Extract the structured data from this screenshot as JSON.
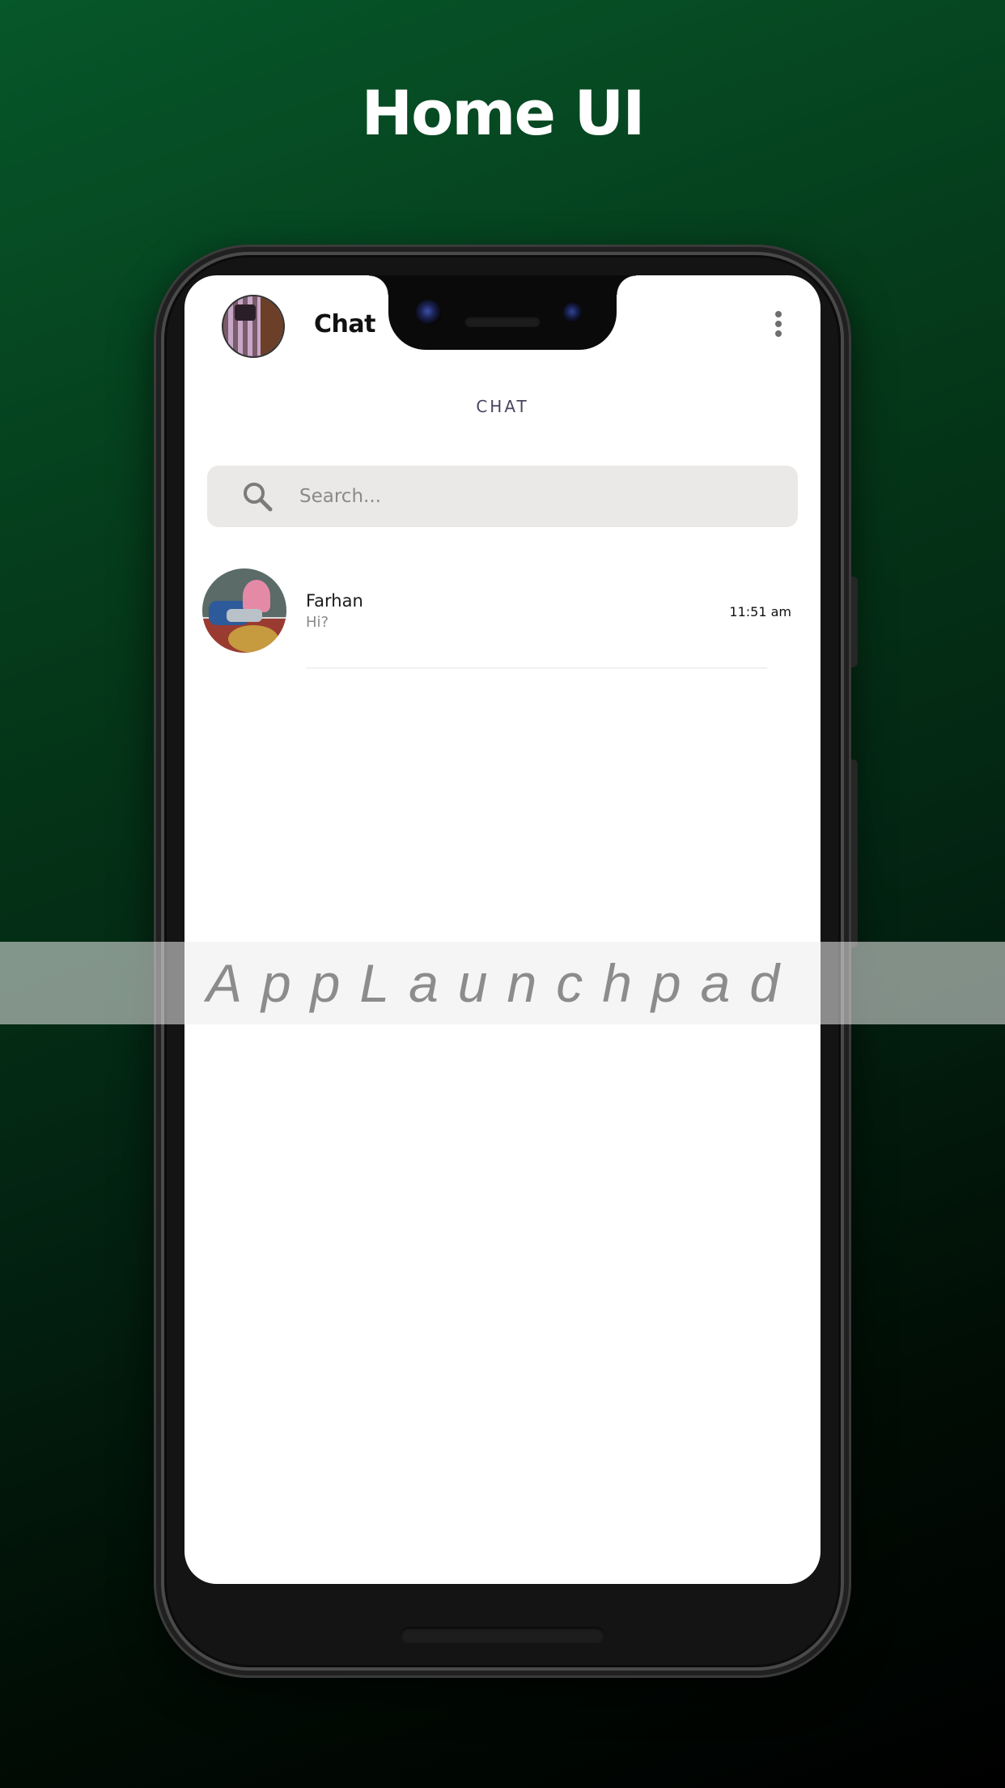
{
  "promo": {
    "headline": "Home UI",
    "watermark": "AppLaunchpad"
  },
  "app_bar": {
    "title": "Chat",
    "menu_icon": "more-vertical-icon",
    "avatar_icon": "profile-avatar"
  },
  "section": {
    "label": "CHAT"
  },
  "search": {
    "placeholder": "Search...",
    "icon": "search-icon"
  },
  "chats": [
    {
      "name": "Farhan",
      "preview": "Hi?",
      "time": "11:51 am"
    }
  ],
  "colors": {
    "background_top": "#06572a",
    "background_bottom": "#000000",
    "search_bg": "#eae9e8",
    "section_label": "#4a4560"
  }
}
